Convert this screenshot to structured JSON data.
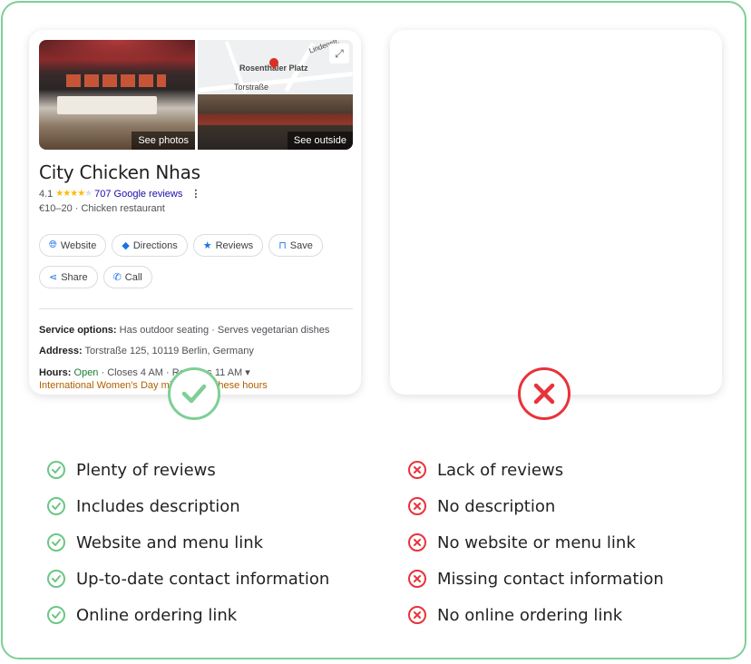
{
  "listing": {
    "see_photos": "See photos",
    "see_outside": "See outside",
    "map_label_square": "Rosenthaler Platz",
    "map_label_street": "Torstraße",
    "map_label_road_top": "Lindenstr.",
    "title": "City Chicken Nhas",
    "rating_value": "4.1",
    "stars": 4,
    "reviews_link": "707 Google reviews",
    "category": "€10–20 · Chicken restaurant",
    "buttons": [
      "Website",
      "Directions",
      "Reviews",
      "Save",
      "Share",
      "Call"
    ],
    "service_label": "Service options:",
    "service_value": "Has outdoor seating · Serves vegetarian dishes",
    "address_label": "Address:",
    "address_value": "Torstraße 125, 10119 Berlin, Germany",
    "hours_label": "Hours:",
    "hours_open": "Open",
    "hours_rest": "· Closes 4 AM · Reopens 11 AM",
    "special_hours": "International Women's Day might affect these hours"
  },
  "pros": [
    "Plenty of reviews",
    "Includes description",
    "Website and menu link",
    "Up-to-date contact information",
    "Online ordering link"
  ],
  "cons": [
    "Lack of reviews",
    "No description",
    "No website or menu link",
    "Missing contact information",
    "No online ordering link"
  ],
  "colors": {
    "border_green": "#7fcf95",
    "check_green": "#6cc785",
    "cross_red": "#e8333a",
    "link_blue": "#1a0dab",
    "star_yellow": "#fbbc04"
  },
  "icons": {
    "expand": "expand-icon",
    "website": "globe-icon",
    "directions": "directions-icon",
    "reviews": "star-icon",
    "save": "bookmark-icon",
    "share": "share-icon",
    "call": "phone-icon",
    "more": "more-vertical-icon",
    "ok_badge": "checkmark-icon",
    "bad_badge": "cross-icon"
  }
}
